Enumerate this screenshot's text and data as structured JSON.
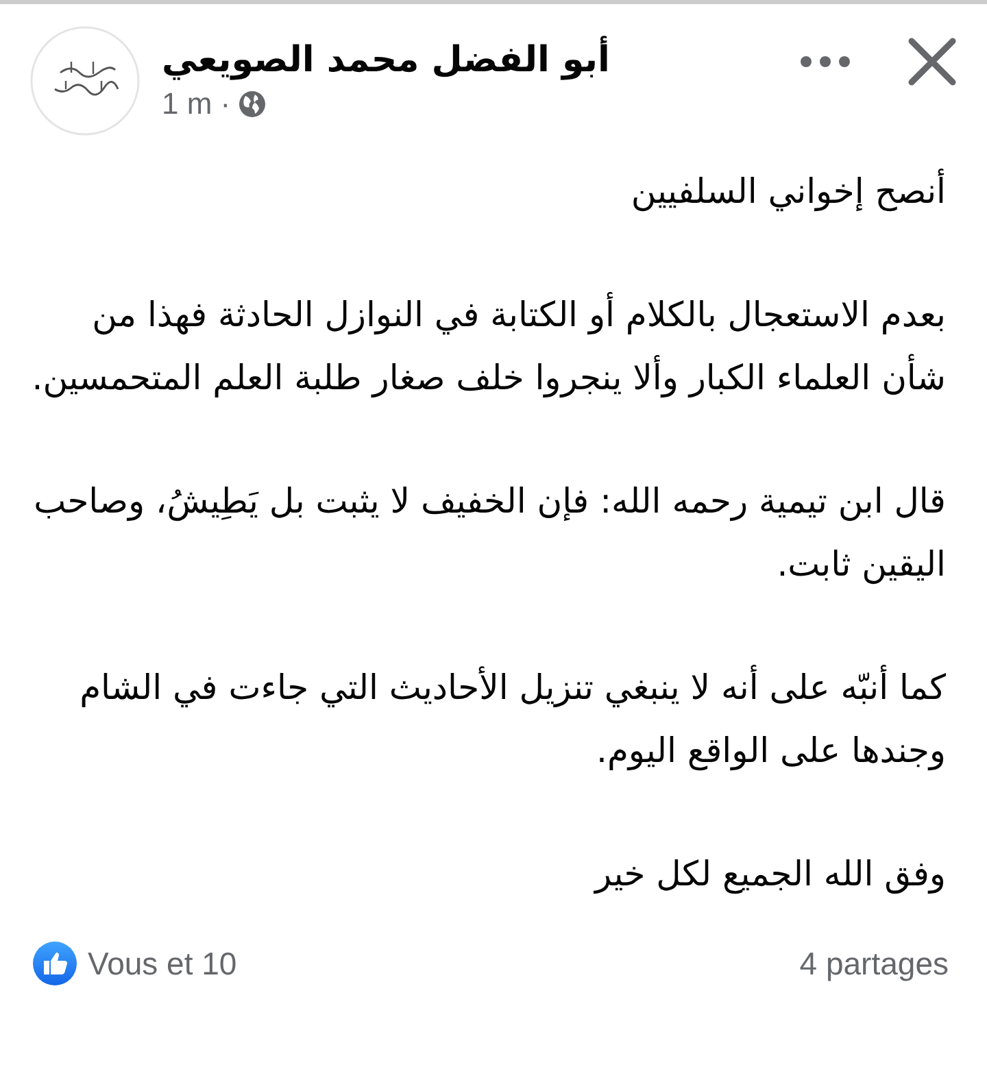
{
  "post": {
    "author": "أبو الفضل محمد الصويعي",
    "time": "1 m",
    "separator": "·",
    "paragraphs": [
      "أنصح إخواني السلفيين",
      "بعدم الاستعجال بالكلام أو الكتابة في النوازل الحادثة فهذا من شأن العلماء الكبار وألا ينجروا خلف صغار طلبة العلم المتحمسين.",
      "قال ابن تيمية رحمه الله: فإن الخفيف لا يثبت بل يَطِيشُ، وصاحب اليقين ثابت.",
      "كما أنبّه على أنه لا ينبغي تنزيل الأحاديث التي جاءت في الشام وجندها على الواقع اليوم.",
      "وفق الله الجميع لكل خير"
    ],
    "reactions": "Vous et 10",
    "shares": "4 partages"
  }
}
